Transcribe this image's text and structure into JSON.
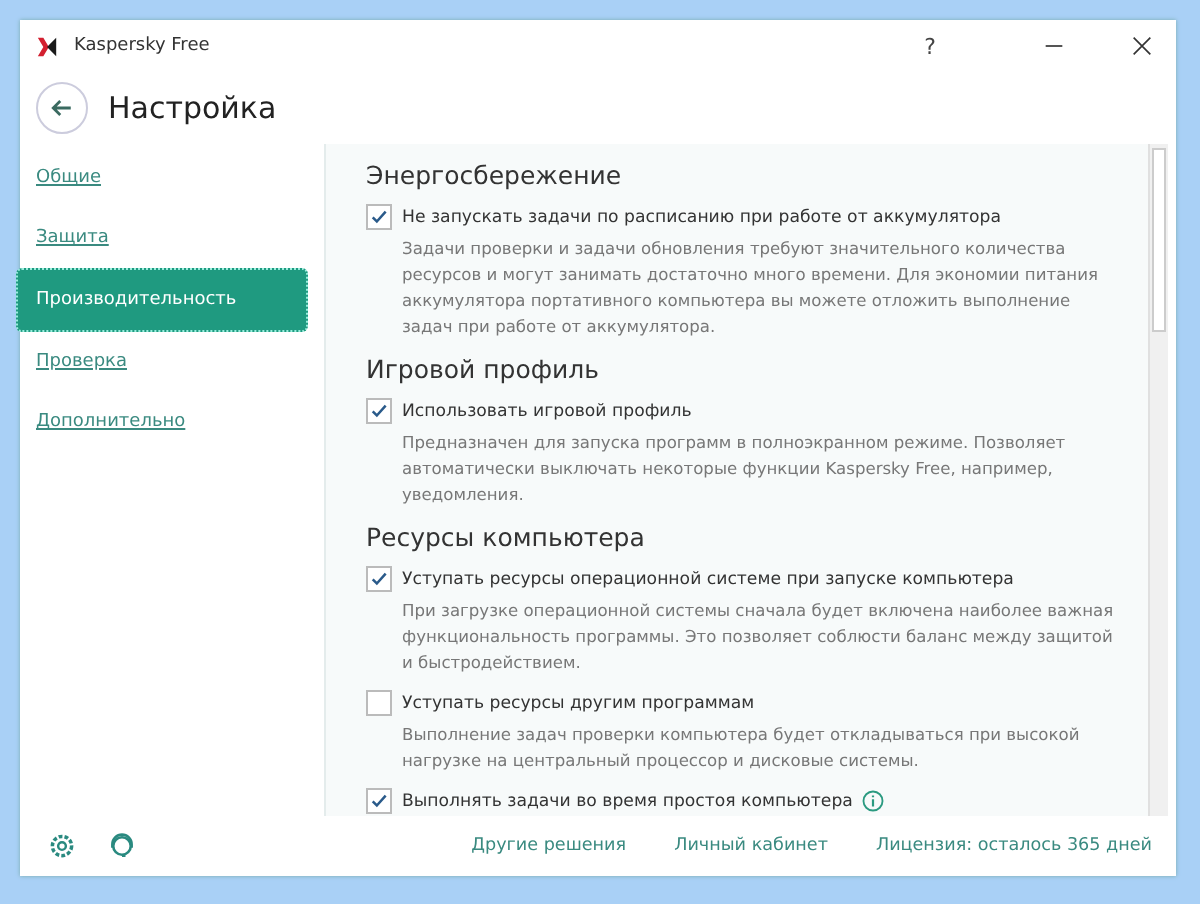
{
  "window": {
    "title": "Kaspersky Free",
    "controls": [
      "?"
    ]
  },
  "header": {
    "title": "Настройка"
  },
  "sidebar": {
    "items": [
      {
        "label": "Общие",
        "selected": false
      },
      {
        "label": "Защита",
        "selected": false
      },
      {
        "label": "Производительность",
        "selected": true
      },
      {
        "label": "Проверка",
        "selected": false
      },
      {
        "label": "Дополнительно",
        "selected": false
      }
    ]
  },
  "sections": [
    {
      "title": "Энергосбережение",
      "items": [
        {
          "label": "Не запускать задачи по расписанию при работе от аккумулятора",
          "checked": true,
          "info": false,
          "description": "Задачи проверки и задачи обновления требуют значительного количества ресурсов и могут занимать достаточно много времени. Для экономии питания аккумулятора портативного компьютера вы можете отложить выполнение задач при работе от аккумулятора."
        }
      ]
    },
    {
      "title": "Игровой профиль",
      "items": [
        {
          "label": "Использовать игровой профиль",
          "checked": true,
          "info": false,
          "description": "Предназначен для запуска программ в полноэкранном режиме. Позволяет автоматически выключать некоторые функции Kaspersky Free, например, уведомления."
        }
      ]
    },
    {
      "title": "Ресурсы компьютера",
      "items": [
        {
          "label": "Уступать ресурсы операционной системе при запуске компьютера",
          "checked": true,
          "info": false,
          "description": "При загрузке операционной системы сначала будет включена наиболее важная функциональность программы. Это позволяет соблюсти баланс между защитой и быстродействием."
        },
        {
          "label": "Уступать ресурсы другим программам",
          "checked": false,
          "info": false,
          "description": "Выполнение задач проверки компьютера будет откладываться при высокой нагрузке на центральный процессор и дисковые системы."
        },
        {
          "label": "Выполнять задачи во время простоя компьютера",
          "checked": true,
          "info": true
        }
      ]
    }
  ],
  "footer": {
    "links": [
      "Другие решения",
      "Личный кабинет",
      "Лицензия: осталось 365 дней"
    ]
  }
}
